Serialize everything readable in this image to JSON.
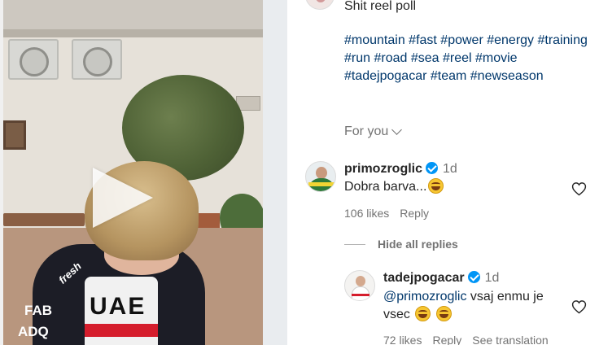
{
  "caption": {
    "title": "Shit reel poll",
    "hashtags": "#mountain #fast #power #energy #training #run #road #sea #reel #movie #tadejpogacar #team #newseason"
  },
  "for_you": {
    "label": "For you"
  },
  "comment_1": {
    "username": "primozroglic",
    "time": "1d",
    "text": "Dobra barva...",
    "likes": "106 likes",
    "reply_label": "Reply"
  },
  "hide_replies": {
    "label": "Hide all replies"
  },
  "reply_1": {
    "username": "tadejpogacar",
    "time": "1d",
    "mention": "@primozroglic",
    "text": " vsaj enmu je vsec",
    "likes": "72 likes",
    "reply_label": "Reply",
    "translation_label": "See translation"
  },
  "video": {
    "jersey_text_main": "UAE",
    "jersey_text_fab": "FAB",
    "jersey_text_adq": "ADQ",
    "jersey_text_sleeve": "fresh"
  },
  "icons": {
    "play": "play-icon",
    "verified": "verified-badge-icon",
    "like": "heart-outline-icon",
    "chevron": "chevron-down-icon",
    "emoji": "grinning-sweat-emoji"
  },
  "colors": {
    "text": "#262626",
    "muted": "#737373",
    "hashtag": "#00376b",
    "verified": "#0095f6"
  }
}
